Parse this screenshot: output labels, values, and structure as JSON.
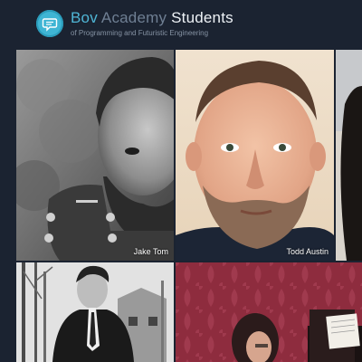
{
  "header": {
    "title_part1": "Bov",
    "title_part2": "Academy",
    "title_part3": "Students",
    "subtitle": "of Programming and Futuristic Engineering",
    "logo_icon": "chat-icon"
  },
  "students": [
    {
      "name": "Jake Tom"
    },
    {
      "name": "Todd Austin"
    },
    {
      "name": ""
    },
    {
      "name": ""
    },
    {
      "name": ""
    },
    {
      "name": ""
    }
  ],
  "colors": {
    "background": "#1b2331",
    "accent": "#4fb6d6",
    "title_mid": "#6f7f93",
    "title_light": "#eef2f6"
  }
}
